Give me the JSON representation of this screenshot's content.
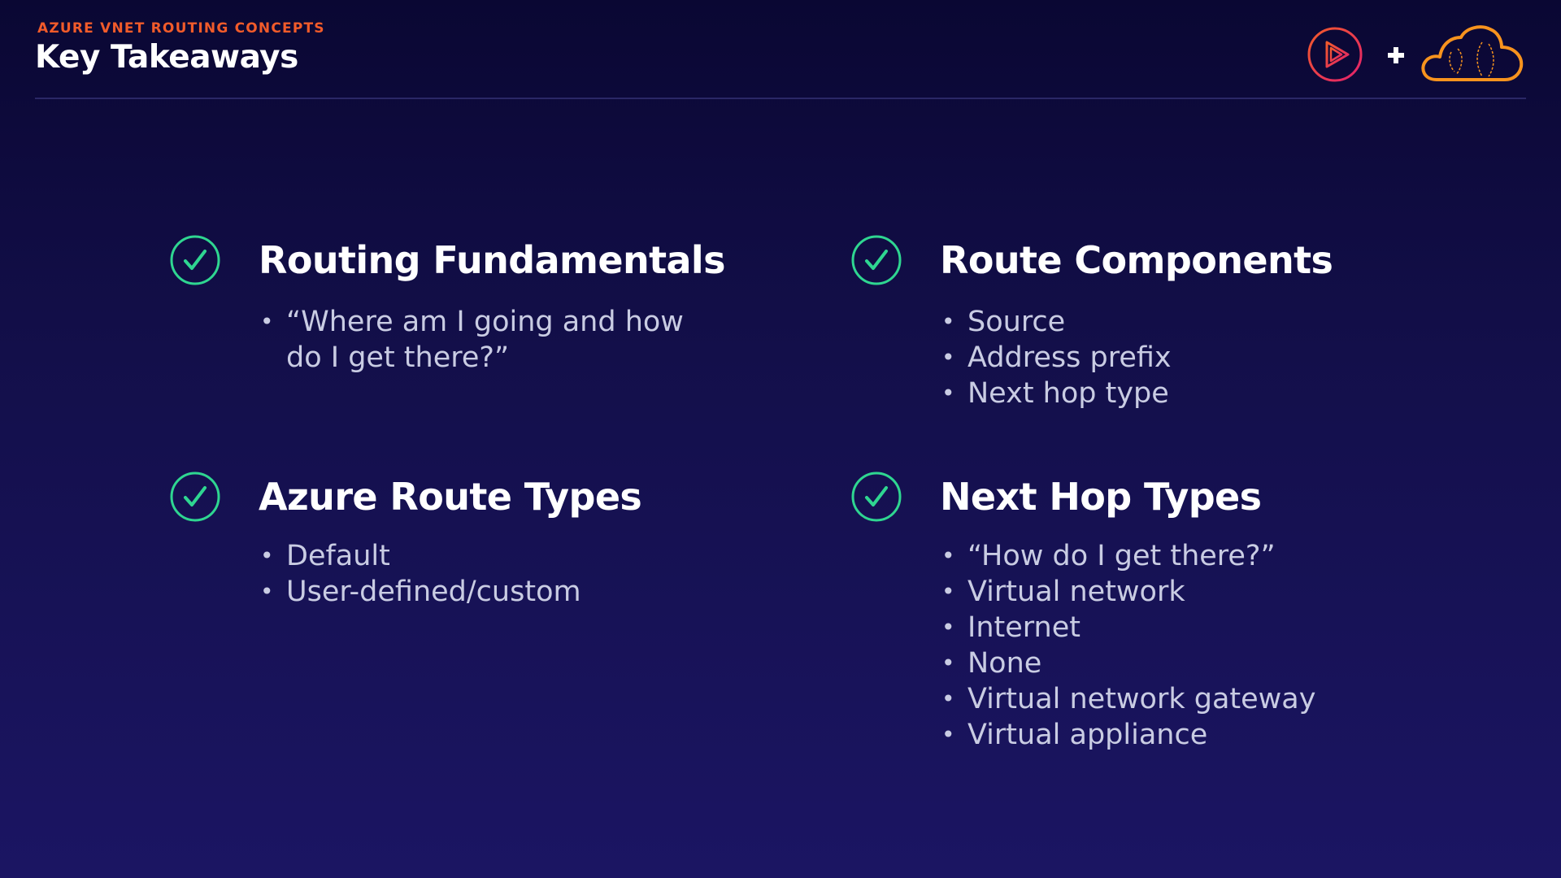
{
  "header": {
    "eyebrow": "AZURE VNET ROUTING CONCEPTS",
    "title": "Key Takeaways",
    "plus_glyph": "+"
  },
  "sections": [
    {
      "icon": "check-circle-icon",
      "heading": "Routing Fundamentals",
      "items": [
        "“Where am I going and how do I get there?”"
      ]
    },
    {
      "icon": "check-circle-icon",
      "heading": "Route Components",
      "items": [
        "Source",
        "Address prefix",
        "Next hop type"
      ]
    },
    {
      "icon": "check-circle-icon",
      "heading": "Azure Route Types",
      "items": [
        "Default",
        "User-defined/custom"
      ]
    },
    {
      "icon": "check-circle-icon",
      "heading": "Next Hop Types",
      "items": [
        "“How do I get there?”",
        "Virtual network",
        "Internet",
        "None",
        "Virtual network gateway",
        "Virtual appliance"
      ]
    }
  ],
  "colors": {
    "background": "#130f4a",
    "accent_orange": "#f15b2a",
    "check_green": "#2fd691",
    "brand_pink": "#e3206d",
    "text_secondary": "#c9cce3"
  }
}
